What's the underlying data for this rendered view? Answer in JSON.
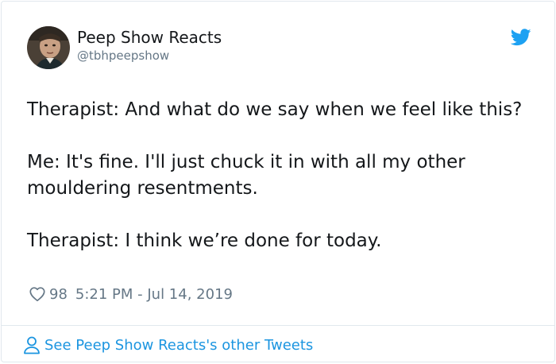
{
  "tweet": {
    "author": {
      "display_name": "Peep Show Reacts",
      "handle": "@tbhpeepshow",
      "avatar_icon": "person-photo-avatar"
    },
    "brand_icon": "twitter-bird-icon",
    "paragraphs": [
      "Therapist: And what do we say when we feel like this?",
      "Me: It's fine. I'll just chuck it in with all my other mouldering resentments.",
      "Therapist: I think we’re done for today."
    ],
    "likes": "98",
    "timestamp": "5:21 PM - Jul 14, 2019"
  },
  "footer": {
    "link_label": "See Peep Show Reacts's other Tweets",
    "icon": "person-icon"
  },
  "colors": {
    "text": "#14171a",
    "secondary": "#657786",
    "link": "#1b95e0",
    "border": "#e1e8ed"
  }
}
